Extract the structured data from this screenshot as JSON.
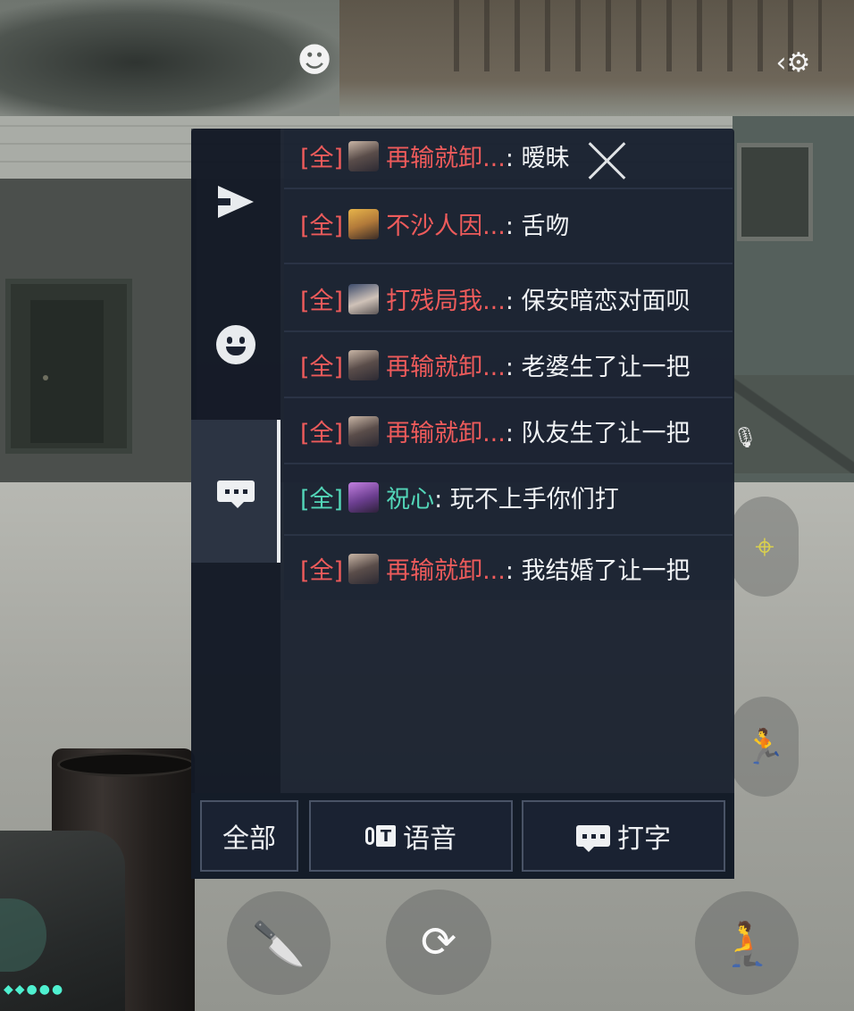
{
  "chat": {
    "messages": [
      {
        "tag": "[全]",
        "name": "再输就卸...",
        "sep": ": ",
        "text": "暧昧",
        "team": "enemy",
        "avatar": "dark-hair-agent"
      },
      {
        "tag": "[全]",
        "name": "不沙人因...",
        "sep": ": ",
        "text": "舌吻",
        "team": "enemy",
        "avatar": "blonde-agent"
      },
      {
        "tag": "[全]",
        "name": "打残局我...",
        "sep": ": ",
        "text": "保安暗恋对面呗",
        "team": "enemy",
        "avatar": "capped-agent"
      },
      {
        "tag": "[全]",
        "name": "再输就卸...",
        "sep": ": ",
        "text": "老婆生了让一把",
        "team": "enemy",
        "avatar": "dark-hair-agent"
      },
      {
        "tag": "[全]",
        "name": "再输就卸...",
        "sep": ": ",
        "text": "队友生了让一把",
        "team": "enemy",
        "avatar": "dark-hair-agent"
      },
      {
        "tag": "[全]",
        "name": "祝心",
        "sep": ": ",
        "text": "玩不上手你们打",
        "team": "ally",
        "avatar": "purple-agent"
      },
      {
        "tag": "[全]",
        "name": "再输就卸...",
        "sep": ": ",
        "text": "我结婚了让一把",
        "team": "enemy",
        "avatar": "dark-hair-agent"
      }
    ],
    "bottom_bar": {
      "all_label": "全部",
      "voice_label": "语音",
      "voice_badge": "T",
      "type_label": "打字"
    },
    "side_rail": {
      "items": [
        "send-icon",
        "emoji-icon",
        "chat-bubble-icon"
      ],
      "active": "chat-bubble-icon"
    }
  },
  "colors": {
    "enemy_name": "#ee5b5b",
    "ally_name": "#53d6b8",
    "panel_bg": "#171e2c"
  },
  "hud": {
    "icons": [
      "emote-icon",
      "settings-icon",
      "close-icon",
      "knife-icon",
      "reload-icon",
      "crouch-icon",
      "jump-icon",
      "scope-icon",
      "mic-off-icon"
    ]
  }
}
